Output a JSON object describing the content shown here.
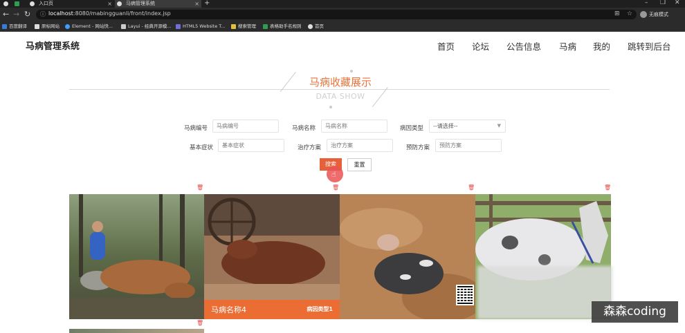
{
  "browser": {
    "tabs": [
      {
        "title": "入口页",
        "active": false
      },
      {
        "title": "马病管理系统",
        "active": true
      }
    ],
    "url_host": "localhost",
    "url_path": ":8080/mabingguanli/front/index.jsp",
    "profile_label": "无痕模式",
    "bookmarks": [
      "百度翻译",
      "原标网站",
      "Element - 网站快...",
      "Layui - 经典开源模...",
      "HTML5 Website T...",
      "搜索管理",
      "表格助手名规则",
      "首页"
    ]
  },
  "header": {
    "logo": "马病管理系统",
    "nav": [
      "首页",
      "论坛",
      "公告信息",
      "马病",
      "我的",
      "跳转到后台"
    ]
  },
  "section": {
    "title_cn": "马病收藏展示",
    "title_en": "DATA SHOW"
  },
  "search": {
    "fields": [
      {
        "label": "马病编号",
        "placeholder": "马病编号"
      },
      {
        "label": "马病名称",
        "placeholder": "马病名称"
      },
      {
        "label": "病因类型",
        "value": "--请选择--"
      },
      {
        "label": "基本症状",
        "placeholder": "基本症状"
      },
      {
        "label": "治疗方案",
        "placeholder": "治疗方案"
      },
      {
        "label": "预防方案",
        "placeholder": "预防方案"
      }
    ],
    "search_label": "搜索",
    "reset_label": "重置"
  },
  "cards": [
    {
      "name": "",
      "type": ""
    },
    {
      "name": "马病名称4",
      "type": "病因类型1"
    },
    {
      "name": "",
      "type": ""
    },
    {
      "name": "",
      "type": ""
    }
  ],
  "watermark": "森森coding",
  "colors": {
    "accent": "#e8733a",
    "caption": "#ee6c32",
    "trash": "#e64545"
  }
}
